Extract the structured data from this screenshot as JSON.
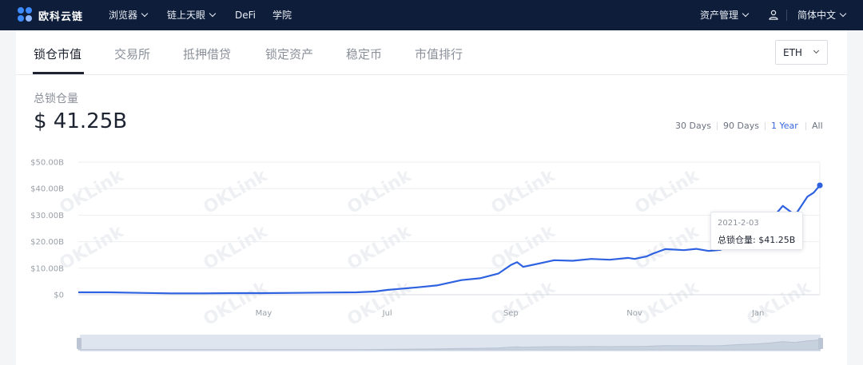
{
  "app": {
    "logo_text": "欧科云链"
  },
  "nav": {
    "items": [
      "浏览器",
      "链上天眼",
      "DeFi",
      "学院"
    ],
    "asset_mgmt": "资产管理",
    "language": "简体中文"
  },
  "tabs": [
    "锁仓市值",
    "交易所",
    "抵押借贷",
    "锁定资产",
    "稳定币",
    "市值排行"
  ],
  "currency_select": "ETH",
  "metric": {
    "label": "总锁仓量",
    "value": "$ 41.25B"
  },
  "ranges": {
    "items": [
      "30 Days",
      "90 Days",
      "1 Year",
      "All"
    ],
    "active": "1 Year"
  },
  "tooltip": {
    "date": "2021-2-03",
    "label": "总锁仓量:",
    "value": "$41.25B"
  },
  "colors": {
    "line": "#2f62e0",
    "nav_bg": "#0e1e3a",
    "accent": "#3566e0"
  },
  "watermark": "OKLink",
  "chart_data": {
    "type": "line",
    "y_ticks": [
      "$0",
      "$10.00B",
      "$20.00B",
      "$30.00B",
      "$40.00B",
      "$50.00B"
    ],
    "x_ticks": [
      "May",
      "Jul",
      "Sep",
      "Nov",
      "Jan"
    ],
    "ylim": [
      0,
      50
    ],
    "y_unit": "B USD",
    "grid": true,
    "series": [
      {
        "values_x_months_from_feb2020": [
          0,
          0.5,
          1,
          1.5,
          2,
          2.5,
          3,
          3.5,
          4,
          4.5,
          4.8,
          5,
          5.2,
          5.5,
          5.8,
          6.0,
          6.2,
          6.5,
          6.8,
          7.0,
          7.1,
          7.2,
          7.3,
          7.5,
          7.7,
          8.0,
          8.3,
          8.6,
          8.9,
          9.0,
          9.2,
          9.3,
          9.5,
          9.8,
          10.0,
          10.2,
          10.4,
          10.5,
          10.7,
          11.0,
          11.2,
          11.4,
          11.6,
          11.8,
          11.9,
          12.0
        ],
        "values": [
          0.9,
          0.9,
          0.7,
          0.5,
          0.5,
          0.6,
          0.6,
          0.7,
          0.8,
          0.9,
          1.2,
          1.8,
          2.2,
          2.8,
          3.5,
          4.5,
          5.5,
          6.2,
          8.0,
          11.2,
          12.3,
          10.5,
          11.0,
          12.0,
          13.0,
          12.8,
          13.5,
          13.2,
          13.9,
          13.5,
          14.5,
          15.5,
          17.2,
          16.8,
          17.3,
          16.5,
          17.0,
          19.0,
          21.5,
          24.5,
          28.0,
          33.5,
          30.0,
          37.0,
          38.5,
          41.25
        ]
      }
    ]
  }
}
